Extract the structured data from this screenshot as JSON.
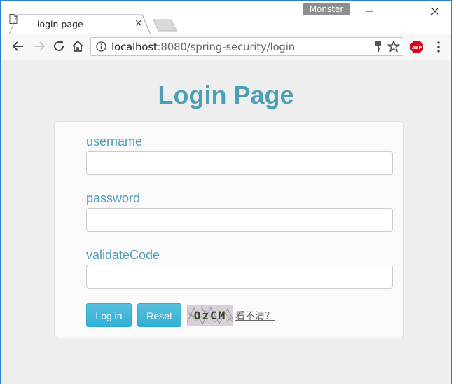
{
  "browser": {
    "tab": {
      "title": "login page",
      "close_symbol": "×"
    },
    "profile_name": "Monster",
    "address": {
      "host": "localhost",
      "rest": ":8080/spring-security/login"
    },
    "extension_label": "ABP"
  },
  "page": {
    "title": "Login Page",
    "form": {
      "username_label": "username",
      "username_value": "",
      "password_label": "password",
      "password_value": "",
      "validate_code_label": "validateCode",
      "validate_code_value": "",
      "login_button": "Log in",
      "reset_button": "Reset",
      "captcha_text": "OzCM",
      "refresh_link": "看不清？"
    }
  },
  "colors": {
    "accent": "#4e9eb8",
    "button": "#31b0d5",
    "abp": "#e0001a"
  }
}
